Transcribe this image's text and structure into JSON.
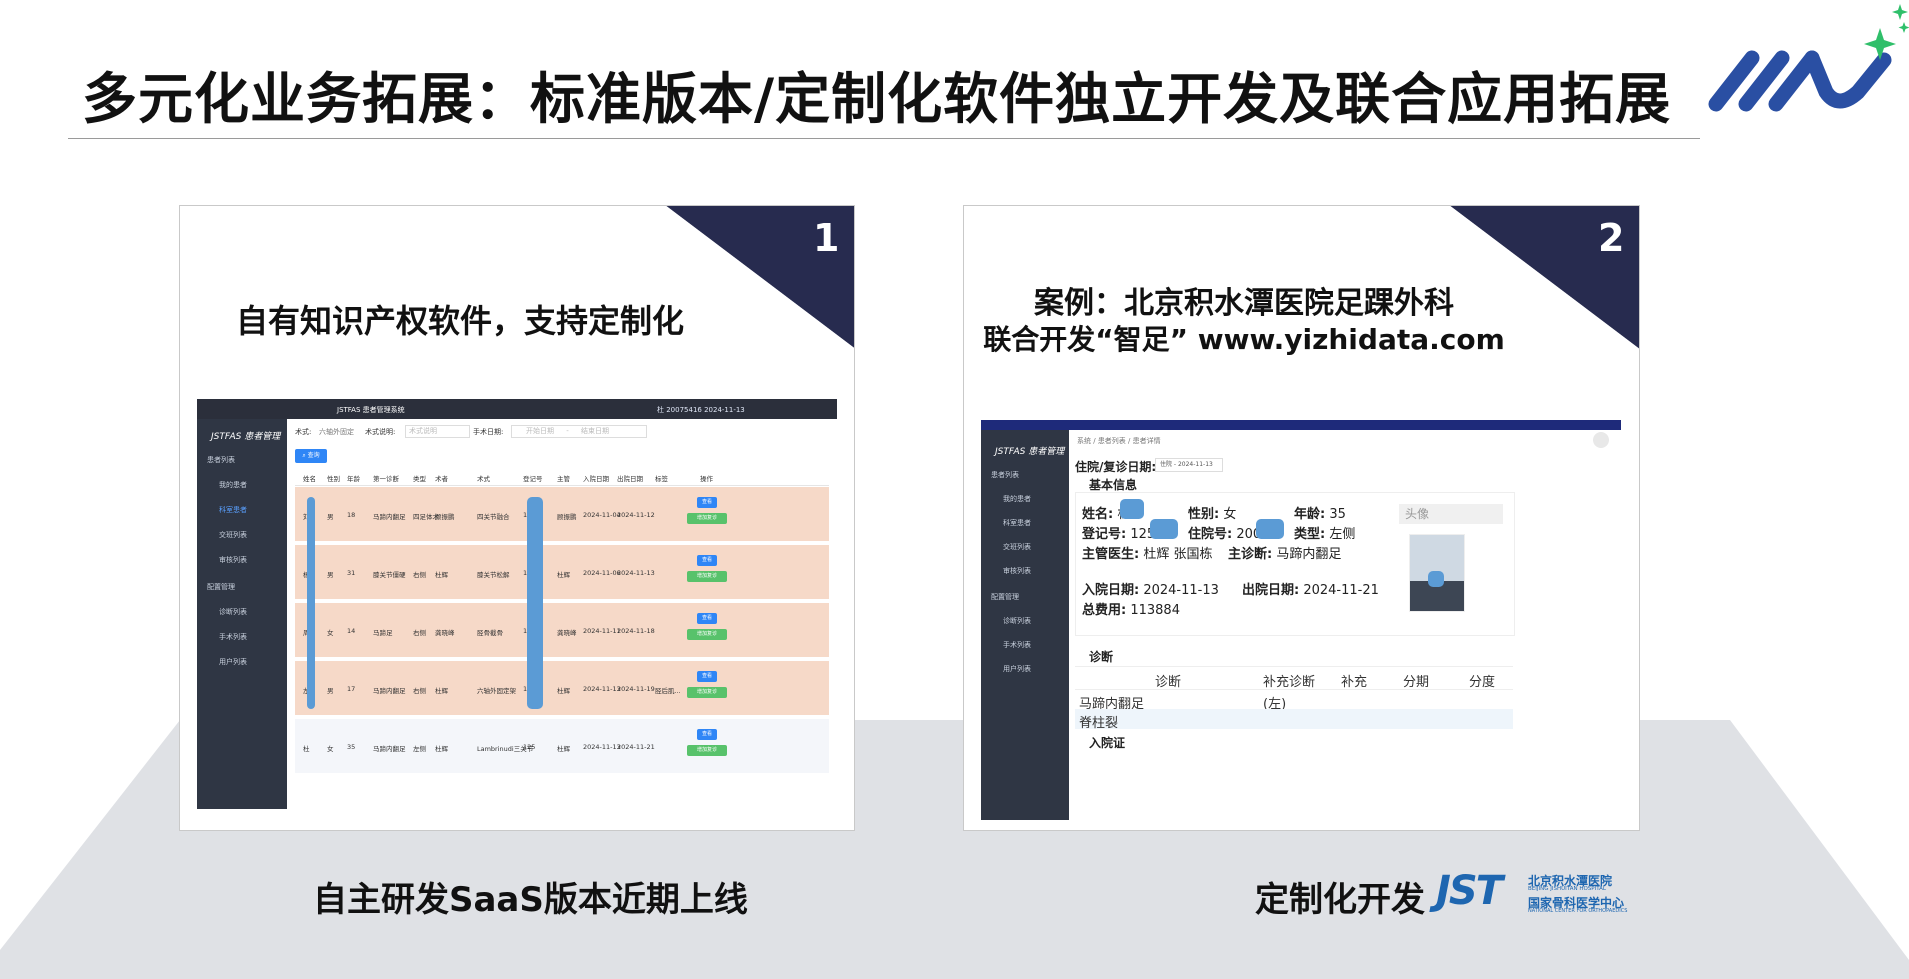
{
  "slide": {
    "title": "多元化业务拓展：标准版本/定制化软件独立开发及联合应用拓展",
    "colors": {
      "dark_navy": "#272b4f",
      "logo_blue": "#2a4fa3",
      "logo_green": "#2fbf6a",
      "stage_gray": "#dfe1e5",
      "row_peach": "#f6d9c8"
    }
  },
  "card1": {
    "number": "1",
    "caption": "自有知识产权软件，支持定制化",
    "bottom_label": "自主研发SaaS版本近期上线"
  },
  "card2": {
    "number": "2",
    "caption_line1": "案例：北京积水潭医院足踝外科",
    "caption_line2": "联合开发“智足” www.yizhidata.com",
    "bottom_label": "定制化开发"
  },
  "hospital_logo": {
    "mark": "JST",
    "cn_name": "北京积水潭医院",
    "en_name": "BEIJING JISHUITAN HOSPITAL",
    "cn_center": "国家骨科医学中心",
    "en_center": "NATIONAL CENTER FOR ORTHOPAEDICS"
  },
  "app1": {
    "window_title": "JSTFAS 患者管理系统",
    "window_right": "杜 20075416 2024-11-13",
    "brand": "JSTFAS 患者管理",
    "sidebar": [
      {
        "label": "患者列表",
        "icon": "person-icon",
        "level": 0
      },
      {
        "label": "我的患者",
        "icon": "list-icon",
        "level": 1
      },
      {
        "label": "科室患者",
        "icon": "grid-icon",
        "level": 1,
        "active": true
      },
      {
        "label": "交班列表",
        "icon": "doc-icon",
        "level": 1
      },
      {
        "label": "审核列表",
        "icon": "check-icon",
        "level": 1
      },
      {
        "label": "配置管理",
        "icon": "gear-icon",
        "level": 0
      },
      {
        "label": "诊断列表",
        "level": 1
      },
      {
        "label": "手术列表",
        "level": 1
      },
      {
        "label": "用户列表",
        "level": 1
      }
    ],
    "filters": {
      "surgery_label": "术式:",
      "surgery_value": "六轴外固定",
      "desc_label": "术式说明:",
      "desc_placeholder": "术式说明",
      "date_label": "手术日期:",
      "date_start_placeholder": "开始日期",
      "date_sep": "-",
      "date_end_placeholder": "结束日期",
      "search_button": "查询"
    },
    "columns": [
      "姓名",
      "性别",
      "年龄",
      "第一诊断",
      "类型",
      "术者",
      "术式",
      "登记号",
      "主管",
      "入院日期",
      "出院日期",
      "标签",
      "操作"
    ],
    "rows": [
      [
        "刘",
        "男",
        "18",
        "马蹄内翻足",
        "四足体术",
        "顾振鹏",
        "四关节融合",
        "135",
        "顾振鹏",
        "2024-11-04",
        "2024-11-12",
        ""
      ],
      [
        "杨",
        "男",
        "31",
        "膝关节僵硬",
        "右侧",
        "杜辉",
        "膝关节松解",
        "118",
        "杜辉",
        "2024-11-06",
        "2024-11-13",
        ""
      ],
      [
        "周",
        "女",
        "14",
        "马蹄足",
        "右侧",
        "龚晓峰",
        "胫骨截骨",
        "118",
        "龚晓峰",
        "2024-11-11",
        "2024-11-18",
        ""
      ],
      [
        "左",
        "男",
        "17",
        "马蹄内翻足",
        "右侧",
        "杜辉",
        "六轴外固定架",
        "120",
        "杜辉",
        "2024-11-13",
        "2024-11-19",
        "胫后肌..."
      ],
      [
        "杜",
        "女",
        "35",
        "马蹄内翻足",
        "左侧",
        "杜辉",
        "Lambrinudi三关节",
        "125",
        "杜辉",
        "2024-11-13",
        "2024-11-21",
        ""
      ]
    ],
    "view_button": "查看",
    "review_button": "增加复诊"
  },
  "app2": {
    "brand": "JSTFAS 患者管理",
    "breadcrumb": [
      "系统",
      "患者列表",
      "患者详情"
    ],
    "sidebar": [
      {
        "label": "患者列表",
        "icon": "person-icon",
        "level": 0
      },
      {
        "label": "我的患者",
        "icon": "list-icon",
        "level": 1
      },
      {
        "label": "科室患者",
        "icon": "grid-icon",
        "level": 1
      },
      {
        "label": "交班列表",
        "icon": "doc-icon",
        "level": 1
      },
      {
        "label": "审核列表",
        "icon": "check-icon",
        "level": 1
      },
      {
        "label": "配置管理",
        "icon": "gear-icon",
        "level": 0
      },
      {
        "label": "诊断列表",
        "level": 1
      },
      {
        "label": "手术列表",
        "level": 1
      },
      {
        "label": "用户列表",
        "level": 1
      }
    ],
    "visit_date_label": "住院/复诊日期:",
    "visit_date_value": "住院 - 2024-11-13",
    "basic_info_title": "基本信息",
    "fields": {
      "name_label": "姓名:",
      "name_value": "杜",
      "gender_label": "性别:",
      "gender_value": "女",
      "age_label": "年龄:",
      "age_value": "35",
      "reg_label": "登记号:",
      "reg_value": "125",
      "inpatient_label": "住院号:",
      "inpatient_value": "200",
      "type_label": "类型:",
      "type_value": "左侧",
      "doctor_label": "主管医生:",
      "doctor_value": "杜辉 张国栋",
      "diag_label": "主诊断:",
      "diag_value": "马蹄内翻足",
      "admit_label": "入院日期:",
      "admit_value": "2024-11-13",
      "discharge_label": "出院日期:",
      "discharge_value": "2024-11-21",
      "cost_label": "总费用:",
      "cost_value": "113884"
    },
    "avatar_label": "头像",
    "diagnosis_title": "诊断",
    "diagnosis_columns": [
      "诊断",
      "补充诊断",
      "补充",
      "分期",
      "分度"
    ],
    "diagnosis_rows": [
      [
        "马蹄内翻足",
        "(左)",
        "",
        "",
        ""
      ],
      [
        "脊柱裂",
        "",
        "",
        "",
        ""
      ]
    ],
    "admission_title": "入院证"
  }
}
